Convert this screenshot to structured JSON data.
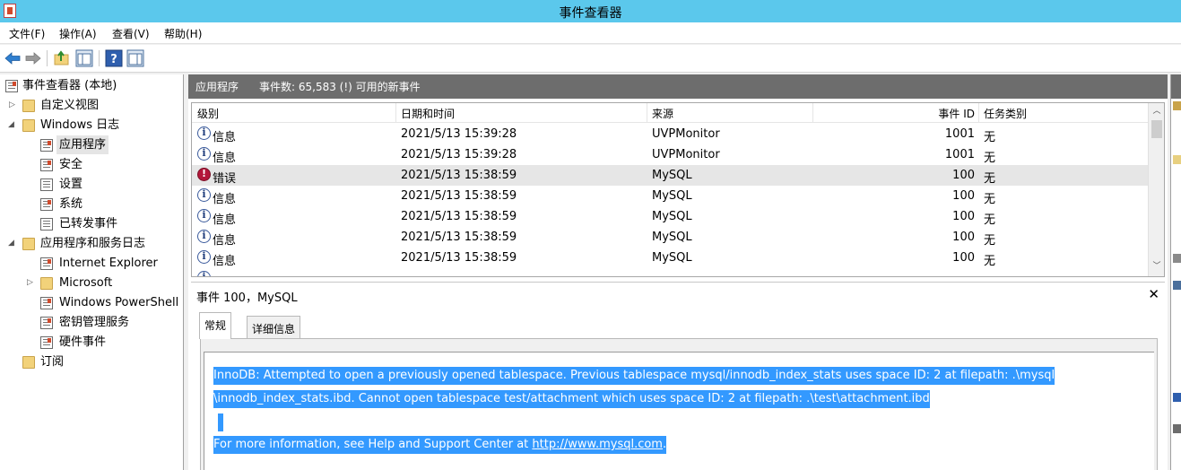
{
  "window": {
    "title": "事件查看器"
  },
  "menu": [
    "文件(F)",
    "操作(A)",
    "查看(V)",
    "帮助(H)"
  ],
  "toolbar": {
    "buttons": [
      "back-arrow-icon",
      "forward-arrow-icon",
      "folder-up-icon",
      "show-hide-tree-icon",
      "help-icon",
      "show-hide-action-pane-icon"
    ]
  },
  "tree": {
    "root": "事件查看器 (本地)",
    "custom_views": "自定义视图",
    "windows_logs": "Windows 日志",
    "application": "应用程序",
    "security": "安全",
    "setup": "设置",
    "system": "系统",
    "forwarded": "已转发事件",
    "app_service_logs": "应用程序和服务日志",
    "internet_explorer": "Internet Explorer",
    "microsoft": "Microsoft",
    "powershell": "Windows PowerShell",
    "key_management": "密钥管理服务",
    "hardware_events": "硬件事件",
    "subscriptions": "订阅"
  },
  "middle": {
    "log_name": "应用程序",
    "event_count": "事件数: 65,583 (!) 可用的新事件"
  },
  "grid": {
    "columns": {
      "level": "级别",
      "datetime": "日期和时间",
      "source": "来源",
      "event_id": "事件 ID",
      "task_category": "任务类别"
    },
    "rows": [
      {
        "level": "信息",
        "icon": "info-icon",
        "datetime": "2021/5/13 15:39:28",
        "source": "UVPMonitor",
        "event_id": "1001",
        "task": "无"
      },
      {
        "level": "信息",
        "icon": "info-icon",
        "datetime": "2021/5/13 15:39:28",
        "source": "UVPMonitor",
        "event_id": "1001",
        "task": "无"
      },
      {
        "level": "错误",
        "icon": "error-icon",
        "datetime": "2021/5/13 15:38:59",
        "source": "MySQL",
        "event_id": "100",
        "task": "无",
        "selected": true
      },
      {
        "level": "信息",
        "icon": "info-icon",
        "datetime": "2021/5/13 15:38:59",
        "source": "MySQL",
        "event_id": "100",
        "task": "无"
      },
      {
        "level": "信息",
        "icon": "info-icon",
        "datetime": "2021/5/13 15:38:59",
        "source": "MySQL",
        "event_id": "100",
        "task": "无"
      },
      {
        "level": "信息",
        "icon": "info-icon",
        "datetime": "2021/5/13 15:38:59",
        "source": "MySQL",
        "event_id": "100",
        "task": "无"
      },
      {
        "level": "信息",
        "icon": "info-icon",
        "datetime": "2021/5/13 15:38:59",
        "source": "MySQL",
        "event_id": "100",
        "task": "无"
      }
    ]
  },
  "detail": {
    "title": "事件 100，MySQL",
    "tabs": {
      "general": "常规",
      "details": "详细信息"
    },
    "message_line1": "InnoDB: Attempted to open a previously opened tablespace. Previous tablespace mysql/innodb_index_stats uses space ID: 2 at filepath: .\\mysql",
    "message_line2": "\\innodb_index_stats.ibd. Cannot open tablespace test/attachment which uses space ID: 2 at filepath: .\\test\\attachment.ibd",
    "message_line4_prefix": "For more information, see Help and Support Center at ",
    "message_link": "http://www.mysql.com",
    "message_line4_suffix": "."
  },
  "colors": {
    "titlebar": "#5bc8ec",
    "header": "#6d6d6d",
    "selection": "#3399ff"
  }
}
